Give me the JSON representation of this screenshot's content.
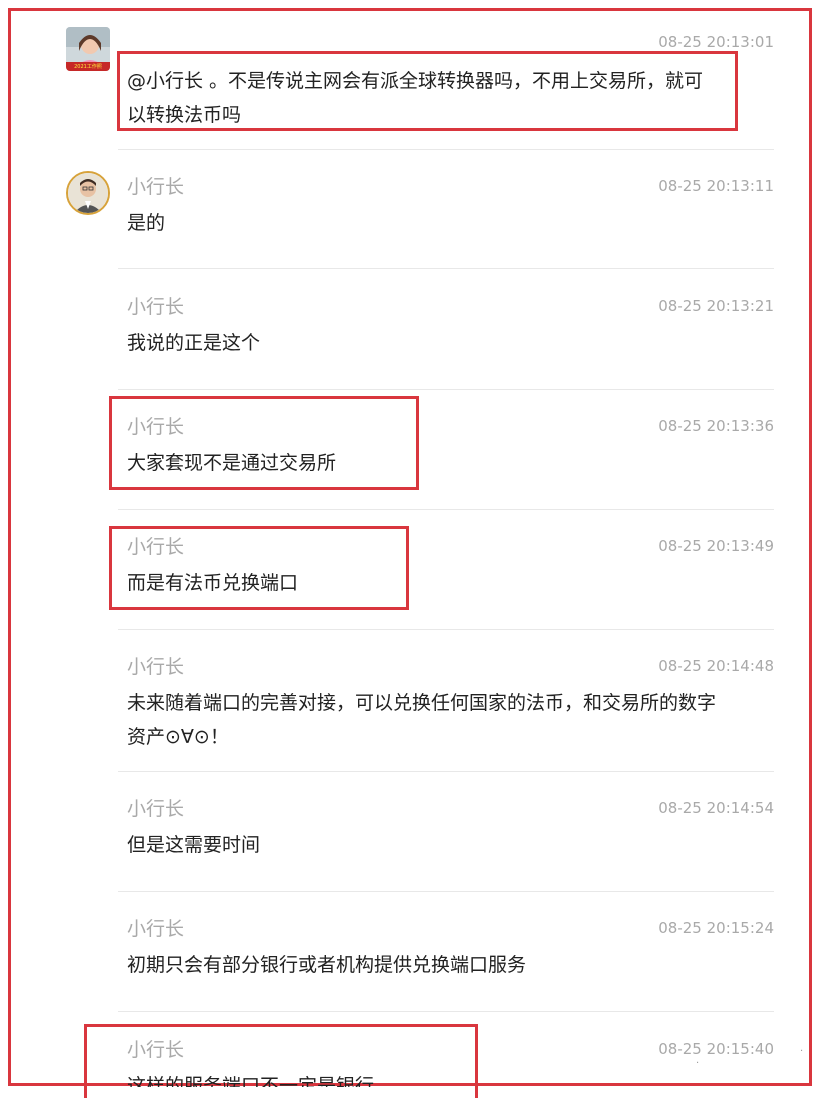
{
  "messages": [
    {
      "sender": "",
      "time": "08-25 20:13:01",
      "text": "@小行长 。不是传说主网会有派全球转换器吗，不用上交易所，就可以转换法币吗"
    },
    {
      "sender": "小行长",
      "time": "08-25 20:13:11",
      "text": "是的"
    },
    {
      "sender": "小行长",
      "time": "08-25 20:13:21",
      "text": "我说的正是这个"
    },
    {
      "sender": "小行长",
      "time": "08-25 20:13:36",
      "text": "大家套现不是通过交易所"
    },
    {
      "sender": "小行长",
      "time": "08-25 20:13:49",
      "text": "而是有法币兑换端口"
    },
    {
      "sender": "小行长",
      "time": "08-25 20:14:48",
      "text": "未来随着端口的完善对接，可以兑换任何国家的法币，和交易所的数字资产⊙∀⊙！"
    },
    {
      "sender": "小行长",
      "time": "08-25 20:14:54",
      "text": "但是这需要时间"
    },
    {
      "sender": "小行长",
      "time": "08-25 20:15:24",
      "text": "初期只会有部分银行或者机构提供兑换端口服务"
    },
    {
      "sender": "小行长",
      "time": "08-25 20:15:40",
      "text": "这样的服务端口不一定是银行"
    }
  ],
  "avatar_badge": "2021工作照",
  "colors": {
    "highlight": "#d9363e",
    "meta": "#a9a9a9",
    "text": "#222222"
  }
}
